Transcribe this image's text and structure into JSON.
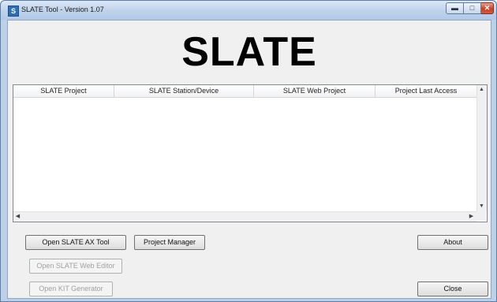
{
  "window": {
    "title": "SLATE Tool - Version 1.07",
    "app_icon_letter": "S",
    "minimize_glyph": "▬",
    "maximize_glyph": "□",
    "close_glyph": "✕"
  },
  "logo": {
    "text": "SLATE"
  },
  "table": {
    "columns": [
      "SLATE Project",
      "SLATE Station/Device",
      "SLATE Web Project",
      "Project Last Access"
    ],
    "rows": []
  },
  "scroll_glyphs": {
    "up": "▲",
    "down": "▼",
    "left": "◀",
    "right": "▶"
  },
  "buttons": {
    "open_ax_tool": "Open SLATE AX Tool",
    "project_manager": "Project Manager",
    "about": "About",
    "open_web_editor": "Open SLATE Web Editor",
    "open_kit_generator": "Open KIT Generator",
    "close": "Close"
  }
}
